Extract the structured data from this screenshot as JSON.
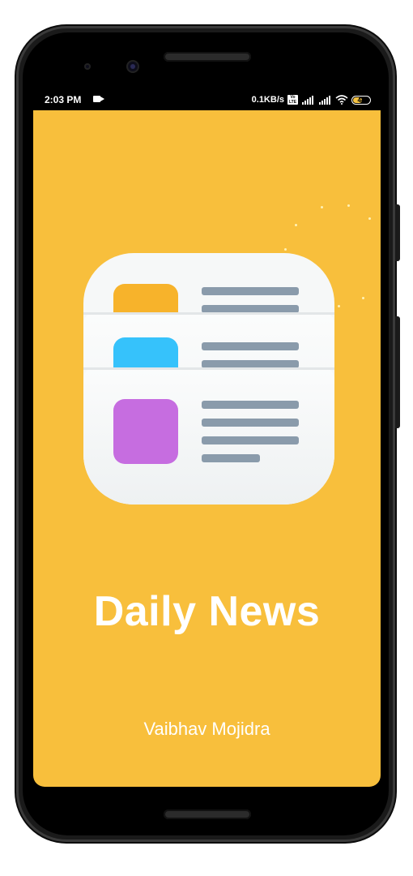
{
  "status_bar": {
    "time": "2:03 PM",
    "net_speed": "0.1KB/s",
    "volte": "Vo LTE",
    "battery": "44"
  },
  "app": {
    "title": "Daily News",
    "author": "Vaibhav Mojidra"
  },
  "colors": {
    "background": "#f8bf3c",
    "card_yellow": "#f7b32b",
    "card_blue": "#36c2fb",
    "card_purple": "#c66de0",
    "text_lines": "#8a9bab"
  },
  "icons": [
    "news-app-icon",
    "camera-status-icon",
    "volte-icon",
    "signal-icon",
    "wifi-icon",
    "battery-icon"
  ]
}
